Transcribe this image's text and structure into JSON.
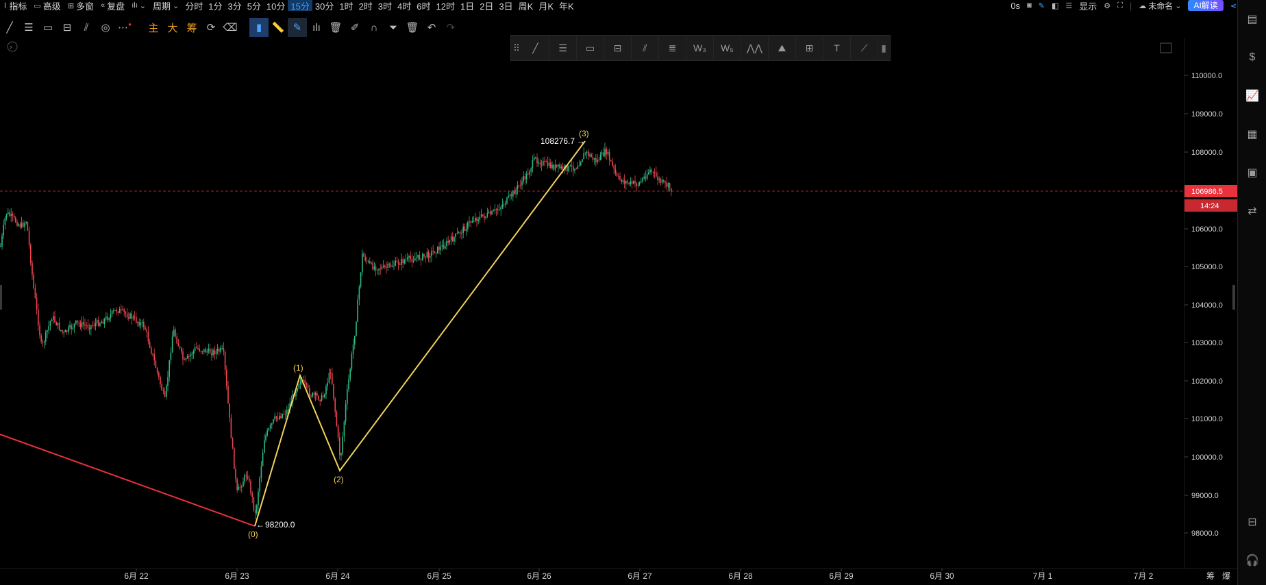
{
  "menu": {
    "indicator": "指标",
    "advanced": "高级",
    "multi_window": "多窗",
    "replay": "复盘",
    "chart_type": "",
    "period": "周期",
    "timeframes": [
      "分时",
      "1分",
      "3分",
      "5分",
      "10分",
      "15分",
      "30分",
      "1时",
      "2时",
      "3时",
      "4时",
      "6时",
      "12时",
      "1日",
      "2日",
      "3日",
      "周K",
      "月K",
      "年K"
    ],
    "active_timeframe": "15分"
  },
  "right_menu": {
    "countdown": "0s",
    "display": "显示",
    "cloud_name": "未命名",
    "ai_button": "AI解读"
  },
  "drawing_toolbar": {
    "main_label": "主",
    "big_label": "大",
    "chip_label": "筹"
  },
  "chart": {
    "last_price": "106986.5",
    "countdown": "14:24",
    "high_label": "108276.7",
    "low_label": "98200.0",
    "wave_labels": [
      "(0)",
      "(1)",
      "(2)",
      "(3)"
    ],
    "y_ticks": [
      "110000.0",
      "109000.0",
      "108000.0",
      "106000.0",
      "105000.0",
      "104000.0",
      "103000.0",
      "102000.0",
      "101000.0",
      "100000.0",
      "99000.0",
      "98000.0"
    ],
    "x_ticks": [
      "6月 22",
      "6月 23",
      "6月 24",
      "6月 25",
      "6月 26",
      "6月 27",
      "6月 28",
      "6月 29",
      "6月 30",
      "7月 1",
      "7月 2"
    ],
    "bottom_right": [
      "筹",
      "爆"
    ],
    "colors": {
      "up": "#2ebd85",
      "down": "#f0464e",
      "wave": "#f2d35a",
      "trend": "#e8323c",
      "last_price_bg": "#e8323c"
    }
  }
}
